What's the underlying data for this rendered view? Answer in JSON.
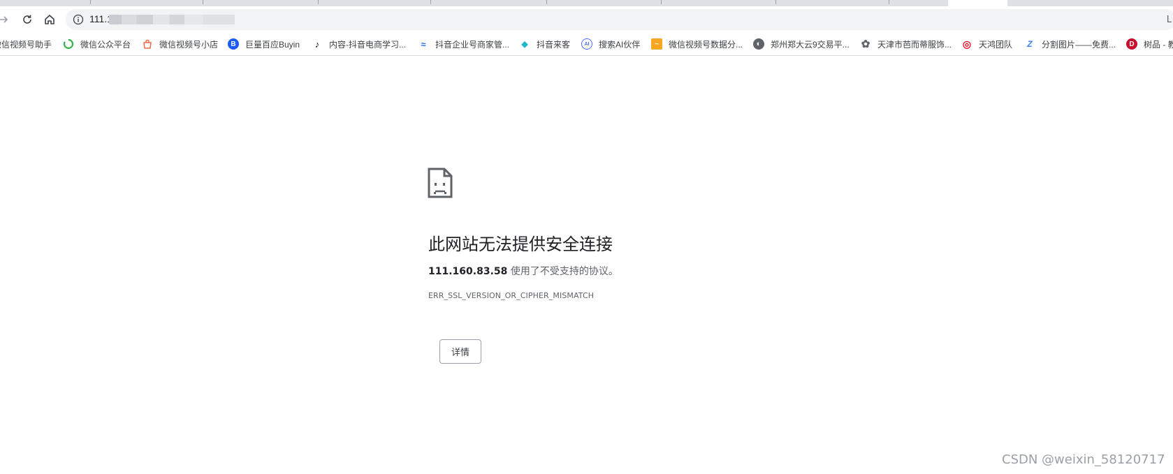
{
  "browser": {
    "address_bar": {
      "url_visible_prefix": "111.1"
    },
    "right_edge_text": "L",
    "bookmarks": [
      {
        "label": "微信视频号助手",
        "icon": "wechat-channels-icon",
        "color": "#f0a020"
      },
      {
        "label": "微信公众平台",
        "icon": "wechat-official-icon",
        "color": "#34b24d"
      },
      {
        "label": "微信视频号小店",
        "icon": "wechat-shop-icon",
        "color": "#f26a4b"
      },
      {
        "label": "巨量百应Buyin",
        "icon": "buyin-icon",
        "color": "#1a5cff",
        "glyph": "B"
      },
      {
        "label": "内容-抖音电商学习...",
        "icon": "tiktok-icon",
        "color": "#111111",
        "glyph": "♪"
      },
      {
        "label": "抖音企业号商家管...",
        "icon": "douyin-enterprise-icon",
        "color": "#2b6cf6",
        "glyph": "≈"
      },
      {
        "label": "抖音来客",
        "icon": "douyin-laike-icon",
        "color": "#20b8c9",
        "glyph": "◆"
      },
      {
        "label": "搜索AI伙伴",
        "icon": "search-ai-icon",
        "color": "#4a6cf7",
        "glyph": "AI"
      },
      {
        "label": "微信视频号数据分...",
        "icon": "data-analysis-icon",
        "color": "#f5a623",
        "glyph": "~"
      },
      {
        "label": "郑州郑大云9交易平...",
        "icon": "globe-icon",
        "color": "#5f6368",
        "glyph": "◐"
      },
      {
        "label": "天津市芭而蒂服饰...",
        "icon": "gear-flower-icon",
        "color": "#5f6368",
        "glyph": "✿"
      },
      {
        "label": "天鸿团队",
        "icon": "weibo-icon",
        "color": "#e6162d",
        "glyph": "◎"
      },
      {
        "label": "分割图片——免费...",
        "icon": "z-icon",
        "color": "#3b82f6",
        "glyph": "Z"
      },
      {
        "label": "树品 - 教",
        "icon": "shupin-icon",
        "color": "#c8102e",
        "glyph": "D"
      }
    ]
  },
  "error": {
    "title": "此网站无法提供安全连接",
    "host": "111.160.83.58",
    "message": " 使用了不受支持的协议。",
    "code": "ERR_SSL_VERSION_OR_CIPHER_MISMATCH",
    "details_label": "详情"
  },
  "watermark": "CSDN @weixin_58120717"
}
